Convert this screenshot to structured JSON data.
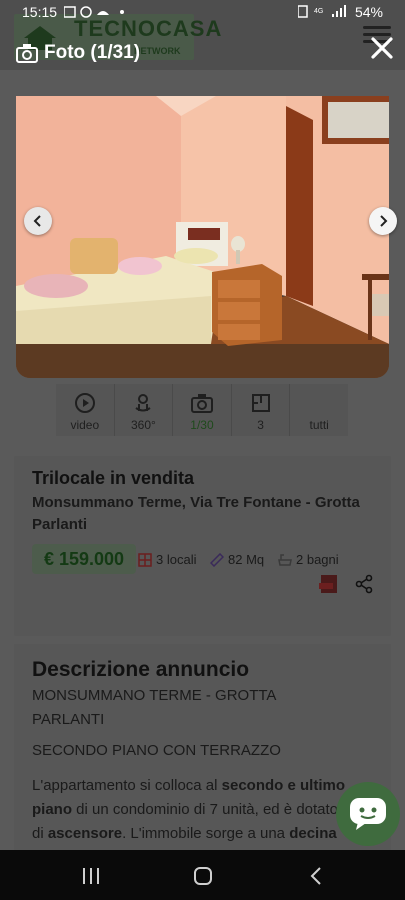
{
  "status_bar": {
    "time": "15:15",
    "battery": "54%"
  },
  "gallery": {
    "title": "Foto (1/31)"
  },
  "logo": {
    "text": "TECNOCASA",
    "sub": "NETWORK"
  },
  "media_tabs": [
    {
      "icon": "play-icon",
      "label": "video"
    },
    {
      "icon": "360-icon",
      "label": "360°"
    },
    {
      "icon": "camera-icon",
      "label": "1/30"
    },
    {
      "icon": "floorplan-icon",
      "label": "3"
    },
    {
      "icon": "none",
      "label": "tutti"
    }
  ],
  "listing": {
    "title": "Trilocale in vendita",
    "address": "Monsummano Terme, Via Tre Fontane - Grotta Parlanti",
    "price": "€ 159.000",
    "rooms": "3 locali",
    "area": "82 Mq",
    "baths": "2 bagni"
  },
  "description": {
    "title": "Descrizione annuncio",
    "subtitle": "MONSUMMANO TERME - GROTTA PARLANTI",
    "subtitle2": "SECONDO PIANO CON TERRAZZO",
    "line1_a": "L'appartamento si colloca al ",
    "line1_b": "secondo e ultimo",
    "line2_a": "piano",
    "line2_b": " di un condominio di 7 unità, ed è dotato",
    "line3_a": "di ",
    "line3_b": "ascensore",
    "line3_c": ". L'immobile sorge a una ",
    "line3_d": "decina"
  },
  "colors": {
    "accent": "#2e7d32",
    "overlay": "#000000"
  }
}
